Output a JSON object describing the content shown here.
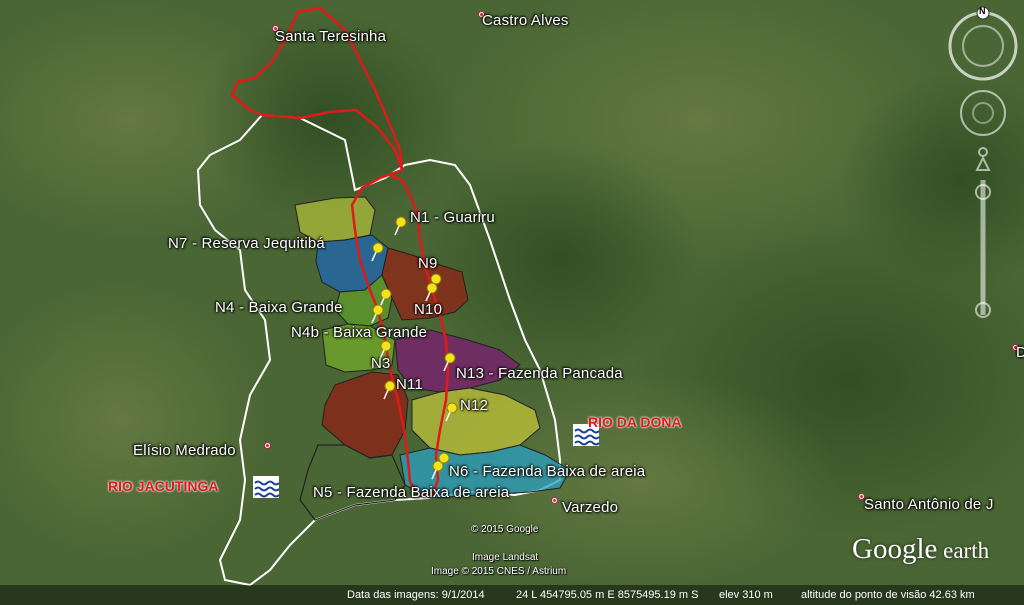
{
  "places": {
    "santa_teresinha": "Santa Teresinha",
    "castro_alves": "Castro Alves",
    "elisio_medrado": "Elísio Medrado",
    "varzedo": "Varzedo",
    "santo_antonio": "Santo Antônio de J",
    "edge_d": "D"
  },
  "rivers": {
    "jacutinga": "RIO JACUTINGA",
    "dona": "RIO DA DONA"
  },
  "nodes": {
    "n1": "N1 - Guariru",
    "n7": "N7 - Reserva Jequitibá",
    "n9": "N9",
    "n10": "N10",
    "n4": "N4 - Baixa Grande",
    "n4b": "N4b - Baixa Grande",
    "n3": "N3",
    "n11": "N11",
    "n13": "N13 - Fazenda Pancada",
    "n12": "N12",
    "n6": "N6 - Fazenda Baixa de areia",
    "n5": "N5 - Fazenda Baixa de areia"
  },
  "credits": {
    "google": "© 2015 Google",
    "landsat": "Image Landsat",
    "cnes": "Image © 2015 CNES / Astrium"
  },
  "status": {
    "imagery_date": "Data das imagens: 9/1/2014",
    "coords": "24 L 454795.05 m E 8575495.19 m S",
    "elev": "elev   310 m",
    "eye_alt": "altitude do ponto de visão  42.63 km"
  },
  "compass_letter": "N",
  "logo": {
    "google": "Google",
    "earth": " earth"
  },
  "colors": {
    "boundary_red": "#e0191b",
    "boundary_white": "#ffffff",
    "pin_yellow": "#f3e21c"
  }
}
